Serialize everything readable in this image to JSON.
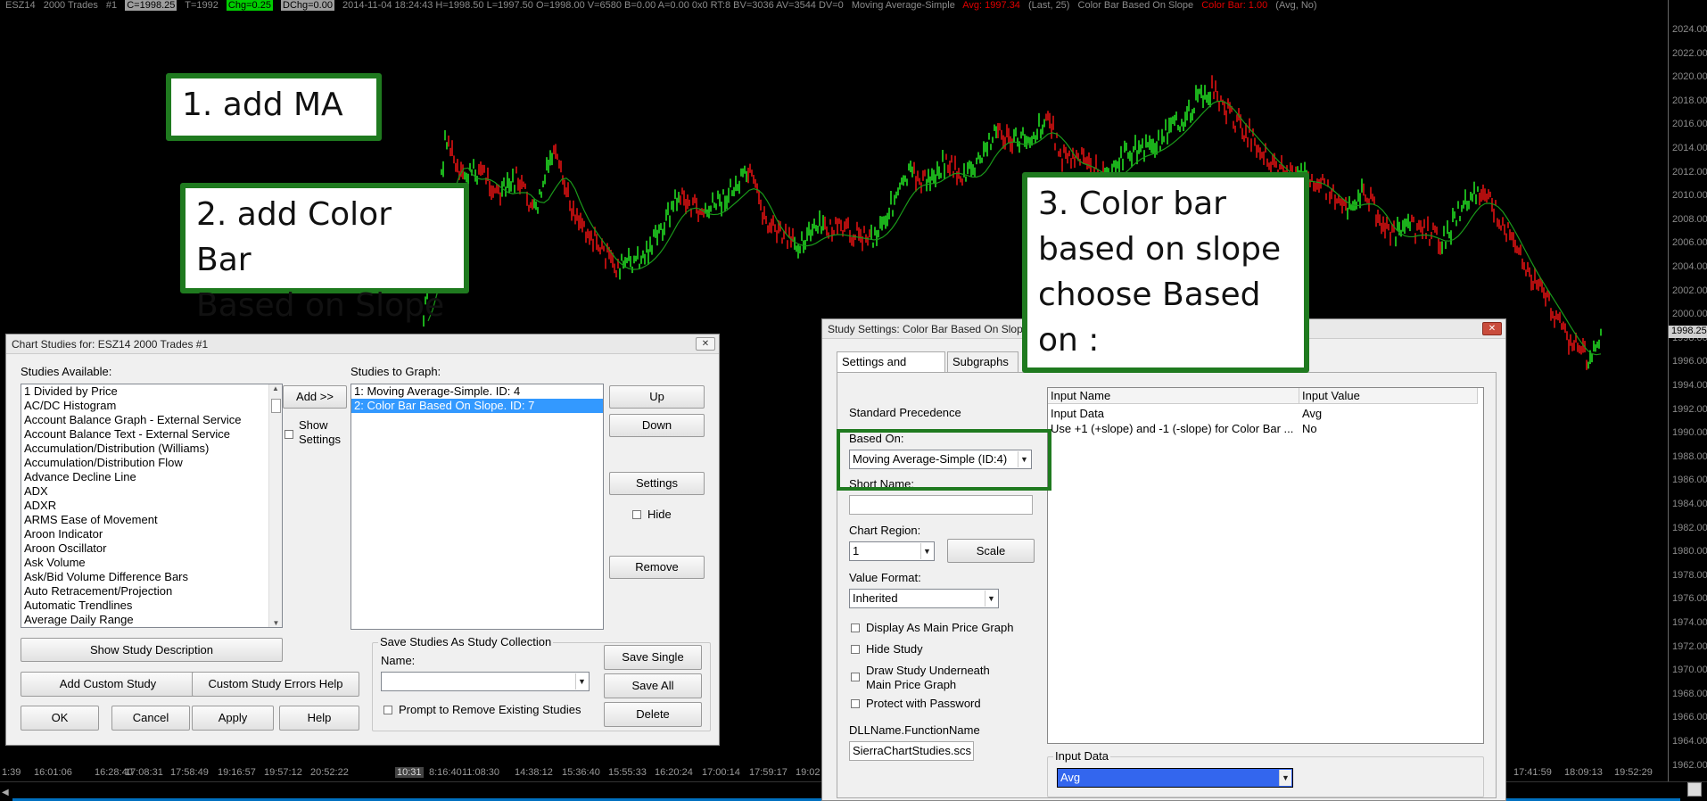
{
  "topbar": {
    "symbol": "ESZ14",
    "bars": "2000 Trades",
    "chart_no": "#1",
    "close": "C=1998.25",
    "trades": "T=1992",
    "chg": "Chg=0.25",
    "dchg": "DChg=0.00",
    "rest": "2014-11-04 18:24:43 H=1998.50 L=1997.50 O=1998.00 V=6580 B=0.00 A=0.00 0x0 RT:8 BV=3036 AV=3544 DV=0",
    "ma_label": "Moving Average-Simple",
    "ma_value": "Avg: 1997.34",
    "ma_params": "(Last, 25)",
    "cb_label": "Color Bar Based On Slope",
    "cb_value": "Color Bar: 1.00",
    "cb_params": "(Avg, No)"
  },
  "price_axis": {
    "labels": [
      "2024.00",
      "2022.00",
      "2020.00",
      "2018.00",
      "2016.00",
      "2014.00",
      "2012.00",
      "2010.00",
      "2008.00",
      "2006.00",
      "2004.00",
      "2002.00",
      "2000.00",
      "1998.00",
      "1996.00",
      "1994.00",
      "1992.00",
      "1990.00",
      "1988.00",
      "1986.00",
      "1984.00",
      "1982.00",
      "1980.00",
      "1978.00",
      "1976.00",
      "1974.00",
      "1972.00",
      "1970.00",
      "1968.00",
      "1966.00",
      "1964.00",
      "1962.00"
    ],
    "current": "1998.25"
  },
  "time_axis": {
    "labels_left": [
      "1:39",
      "16:01:06",
      "16:28:40",
      "17:08:31",
      "17:58:49",
      "19:16:57",
      "19:57:12",
      "20:52:22"
    ],
    "selected": "10:31",
    "labels_mid": [
      "8:16:40",
      "11:08:30",
      "14:38:12",
      "15:36:40",
      "15:55:33",
      "16:20:24",
      "17:00:14",
      "17:59:17",
      "19:02"
    ],
    "labels_right": [
      "17:41:59",
      "18:09:13",
      "19:52:29"
    ]
  },
  "callouts": {
    "c1": "1. add MA",
    "c2_l1": "2. add Color Bar",
    "c2_l2": "Based on Slope",
    "c3_l1": "3. Color bar",
    "c3_l2": "based on slope",
    "c3_l3": "choose Based",
    "c3_l4": "on :"
  },
  "chart_studies": {
    "title": "Chart Studies for: ESZ14  2000 Trades  #1",
    "studies_available_label": "Studies Available:",
    "available": [
      "1 Divided by Price",
      "AC/DC Histogram",
      "Account Balance Graph - External Service",
      "Account Balance Text - External Service",
      "Accumulation/Distribution (Williams)",
      "Accumulation/Distribution Flow",
      "Advance Decline Line",
      "ADX",
      "ADXR",
      "ARMS Ease of Movement",
      "Aroon Indicator",
      "Aroon Oscillator",
      "Ask Volume",
      "Ask/Bid Volume Difference Bars",
      "Auto Retracement/Projection",
      "Automatic Trendlines",
      "Average Daily Range"
    ],
    "add_button": "Add >>",
    "show_settings_label": "Show Settings",
    "studies_to_graph_label": "Studies to Graph:",
    "to_graph": [
      "1: Moving Average-Simple. ID: 4",
      "2: Color Bar Based On Slope. ID: 7"
    ],
    "up": "Up",
    "down": "Down",
    "settings": "Settings",
    "hide": "Hide",
    "remove": "Remove",
    "show_desc": "Show Study Description",
    "add_custom": "Add Custom Study",
    "custom_errors": "Custom Study Errors Help",
    "ok": "OK",
    "cancel": "Cancel",
    "apply": "Apply",
    "help": "Help",
    "save_group": "Save Studies As Study Collection",
    "name_label": "Name:",
    "save_single": "Save Single",
    "save_all": "Save All",
    "delete": "Delete",
    "prompt_remove": "Prompt to Remove Existing Studies"
  },
  "study_settings": {
    "title": "Study Settings: Color Bar Based On Slope",
    "tab1": "Settings and Inputs",
    "tab2": "Subgraphs",
    "standard_precedence": "Standard Precedence",
    "based_on_label": "Based On:",
    "based_on_value": "Moving Average-Simple (ID:4)",
    "short_name_label": "Short Name:",
    "chart_region_label": "Chart Region:",
    "chart_region_value": "1",
    "scale": "Scale",
    "value_format_label": "Value Format:",
    "value_format_value": "Inherited",
    "display_main": "Display As Main Price Graph",
    "hide_study": "Hide Study",
    "draw_under_l1": "Draw Study Underneath",
    "draw_under_l2": "Main Price Graph",
    "protect": "Protect with Password",
    "dll_label": "DLLName.FunctionName",
    "dll_value": "SierraChartStudies.scs",
    "col_name": "Input Name",
    "col_value": "Input Value",
    "inputs": [
      {
        "name": "Input Data",
        "value": "Avg"
      },
      {
        "name": "Use +1 (+slope) and -1 (-slope) for Color Bar ...",
        "value": "No"
      }
    ],
    "input_group": "Input Data",
    "input_value": "Avg"
  }
}
